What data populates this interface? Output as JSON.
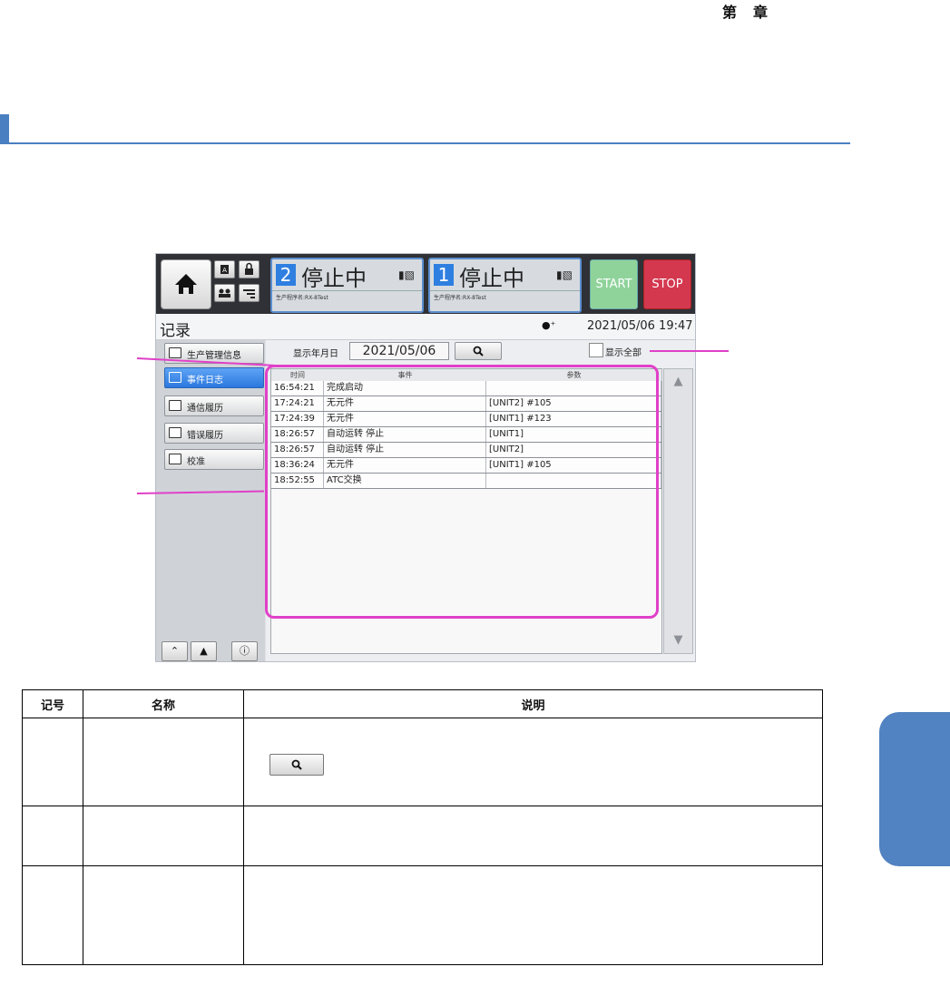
{
  "header": {
    "chapter_prefix": "第",
    "chapter_suffix": "章"
  },
  "hmi": {
    "units": [
      {
        "number": "2",
        "status": "停止中",
        "program": "生产程序名:RX-8Test"
      },
      {
        "number": "1",
        "status": "停止中",
        "program": "生产程序名:RX-8Test"
      }
    ],
    "start_label": "START",
    "stop_label": "STOP",
    "screen_title": "记录",
    "datetime": "2021/05/06 19:47",
    "sidebar": {
      "items": [
        {
          "label": "生产管理信息"
        },
        {
          "label": "事件日志"
        },
        {
          "label": "通信履历"
        },
        {
          "label": "错误履历"
        },
        {
          "label": "校准"
        }
      ]
    },
    "date_filter": {
      "label": "显示年月日",
      "value": "2021/05/06"
    },
    "show_all_label": "显示全部",
    "table": {
      "columns": [
        "时间",
        "事件",
        "参数"
      ],
      "rows": [
        {
          "time": "16:54:21",
          "event": "完成启动",
          "param": ""
        },
        {
          "time": "17:24:21",
          "event": "无元件",
          "param": "[UNIT2] #105"
        },
        {
          "time": "17:24:39",
          "event": "无元件",
          "param": "[UNIT1] #123"
        },
        {
          "time": "18:26:57",
          "event": "自动运转 停止",
          "param": "[UNIT1]"
        },
        {
          "time": "18:26:57",
          "event": "自动运转 停止",
          "param": "[UNIT2]"
        },
        {
          "time": "18:36:24",
          "event": "无元件",
          "param": "[UNIT1] #105"
        },
        {
          "time": "18:52:55",
          "event": "ATC交换",
          "param": ""
        }
      ]
    }
  },
  "spec_table": {
    "headers": [
      "记号",
      "名称",
      "说明"
    ]
  },
  "colors": {
    "accent": "#4a7fc1",
    "highlight": "#e040c8",
    "start": "#8fd39b",
    "stop": "#d3384f"
  }
}
